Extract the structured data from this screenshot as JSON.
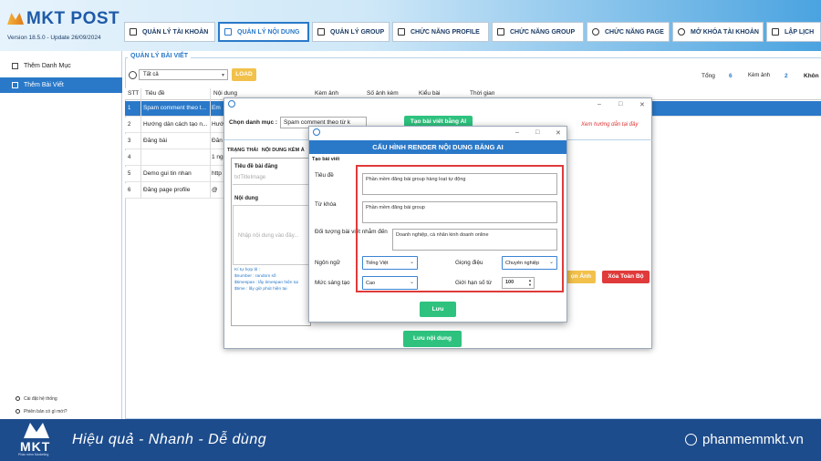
{
  "app": {
    "brand": "MKT POST",
    "version": "Version  18.5.0  - Update  26/09/2024"
  },
  "nav": {
    "tabs": [
      {
        "label": "QUẢN LÝ TÀI KHOẢN",
        "icon": "account-icon"
      },
      {
        "label": "QUẢN LÝ NỘI DUNG",
        "icon": "content-icon",
        "active": true
      },
      {
        "label": "QUẢN LÝ GROUP",
        "icon": "group-icon"
      },
      {
        "label": "CHỨC NĂNG PROFILE",
        "icon": "profile-icon"
      },
      {
        "label": "CHỨC NĂNG GROUP",
        "icon": "group-function-icon"
      },
      {
        "label": "CHỨC NĂNG PAGE",
        "icon": "facebook-icon"
      },
      {
        "label": "MỞ KHÓA TÀI KHOẢN",
        "icon": "unlock-icon"
      },
      {
        "label": "LẬP LỊCH",
        "icon": "calendar-icon"
      }
    ]
  },
  "sidebar": {
    "items": [
      {
        "label": "Thêm Danh Mục",
        "icon": "category-icon"
      },
      {
        "label": "Thêm Bài Viết",
        "icon": "post-icon",
        "selected": true
      }
    ],
    "footer": [
      "Cài đặt hệ thống",
      "Phiên bản có gì mới?"
    ]
  },
  "main": {
    "group_title": "QUẢN LÝ BÀI VIẾT",
    "filter_value": "Tất cả",
    "load_label": "LOAD",
    "stats": {
      "total_label": "Tổng",
      "total": "6",
      "img_label": "Kèm ảnh",
      "img": "2",
      "no_img_label": "Khôn"
    },
    "columns": [
      "STT",
      "Tiêu đề",
      "Nội dung",
      "Kèm ảnh",
      "Số ảnh kèm",
      "Kiểu bài",
      "Thời gian"
    ],
    "rows": [
      {
        "stt": "1",
        "title": "Spam comment theo t...",
        "content": "Em",
        "selected": true
      },
      {
        "stt": "2",
        "title": "Hướng dẫn cách tạo n...",
        "content": "Hướ"
      },
      {
        "stt": "3",
        "title": "Đăng bài",
        "content": "Đăn"
      },
      {
        "stt": "4",
        "title": "",
        "content": "1 ng"
      },
      {
        "stt": "5",
        "title": "Demo gui tin nhan",
        "content": "http"
      },
      {
        "stt": "6",
        "title": "Đăng page profile",
        "content": "@"
      }
    ]
  },
  "editor": {
    "category_label": "Chọn danh mục :",
    "category_value": "Spam comment theo từ k",
    "ai_button": "Tạo bài viết bằng AI",
    "guide_link": "Xem hướng dẫn tại đây",
    "tabs": [
      "TRẠNG THÁI",
      "NỘI DUNG KÈM Ả"
    ],
    "title_label": "Tiêu đề bài đăng",
    "title_placeholder": "txtTitleImage",
    "content_label": "Nội dung",
    "content_placeholder": "Nhập nội dung vào đây...",
    "keywords": [
      "Kí tự hợp lệ :",
      "$number    : random số",
      "$timespan  : lấy timespan hiện tại",
      "$time       : lấy giờ phút hiện tại"
    ],
    "image_button": "ọn Ảnh",
    "delete_all_button": "Xóa Toàn Bộ",
    "save_button": "Lưu nội dung"
  },
  "ai_config": {
    "title": "CẤU HÌNH RENDER NỘI DUNG BẰNG AI",
    "section": "Tạo bài viết",
    "title_label": "Tiêu đề",
    "title_value": "Phần mềm đăng bài group hàng loạt tự động",
    "keyword_label": "Từ khóa",
    "keyword_value": "Phần mềm đăng bài group",
    "audience_label": "Đối tượng bài viết nhắm đến",
    "audience_value": "Doanh nghiệp, cá nhân kinh doanh online",
    "language_label": "Ngôn ngữ",
    "language_value": "Tiếng Việt",
    "tone_label": "Giọng điệu",
    "tone_value": "Chuyên nghiệp",
    "creativity_label": "Mức sáng tạo",
    "creativity_value": "Cao",
    "wordlimit_label": "Giới hạn số từ",
    "wordlimit_value": "100",
    "save_label": "Lưu"
  },
  "footer": {
    "tagline": "Hiệu quả - Nhanh  - Dễ dùng",
    "site": "phanmemmkt.vn",
    "logo_text": "MKT",
    "logo_sub": "Phần mềm Marketing"
  },
  "colors": {
    "primary": "#2a79c9",
    "green": "#2ec27e",
    "yellow": "#f2c14b",
    "red": "#e03a3a",
    "footer": "#1d4c8c"
  }
}
